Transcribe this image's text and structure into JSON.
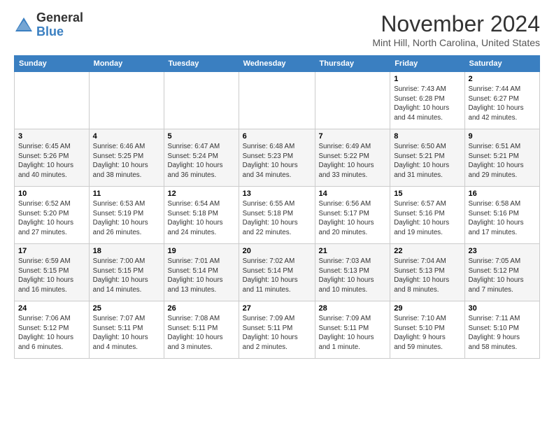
{
  "logo": {
    "general": "General",
    "blue": "Blue"
  },
  "header": {
    "month_title": "November 2024",
    "location": "Mint Hill, North Carolina, United States"
  },
  "weekdays": [
    "Sunday",
    "Monday",
    "Tuesday",
    "Wednesday",
    "Thursday",
    "Friday",
    "Saturday"
  ],
  "weeks": [
    [
      {
        "day": "",
        "detail": ""
      },
      {
        "day": "",
        "detail": ""
      },
      {
        "day": "",
        "detail": ""
      },
      {
        "day": "",
        "detail": ""
      },
      {
        "day": "",
        "detail": ""
      },
      {
        "day": "1",
        "detail": "Sunrise: 7:43 AM\nSunset: 6:28 PM\nDaylight: 10 hours\nand 44 minutes."
      },
      {
        "day": "2",
        "detail": "Sunrise: 7:44 AM\nSunset: 6:27 PM\nDaylight: 10 hours\nand 42 minutes."
      }
    ],
    [
      {
        "day": "3",
        "detail": "Sunrise: 6:45 AM\nSunset: 5:26 PM\nDaylight: 10 hours\nand 40 minutes."
      },
      {
        "day": "4",
        "detail": "Sunrise: 6:46 AM\nSunset: 5:25 PM\nDaylight: 10 hours\nand 38 minutes."
      },
      {
        "day": "5",
        "detail": "Sunrise: 6:47 AM\nSunset: 5:24 PM\nDaylight: 10 hours\nand 36 minutes."
      },
      {
        "day": "6",
        "detail": "Sunrise: 6:48 AM\nSunset: 5:23 PM\nDaylight: 10 hours\nand 34 minutes."
      },
      {
        "day": "7",
        "detail": "Sunrise: 6:49 AM\nSunset: 5:22 PM\nDaylight: 10 hours\nand 33 minutes."
      },
      {
        "day": "8",
        "detail": "Sunrise: 6:50 AM\nSunset: 5:21 PM\nDaylight: 10 hours\nand 31 minutes."
      },
      {
        "day": "9",
        "detail": "Sunrise: 6:51 AM\nSunset: 5:21 PM\nDaylight: 10 hours\nand 29 minutes."
      }
    ],
    [
      {
        "day": "10",
        "detail": "Sunrise: 6:52 AM\nSunset: 5:20 PM\nDaylight: 10 hours\nand 27 minutes."
      },
      {
        "day": "11",
        "detail": "Sunrise: 6:53 AM\nSunset: 5:19 PM\nDaylight: 10 hours\nand 26 minutes."
      },
      {
        "day": "12",
        "detail": "Sunrise: 6:54 AM\nSunset: 5:18 PM\nDaylight: 10 hours\nand 24 minutes."
      },
      {
        "day": "13",
        "detail": "Sunrise: 6:55 AM\nSunset: 5:18 PM\nDaylight: 10 hours\nand 22 minutes."
      },
      {
        "day": "14",
        "detail": "Sunrise: 6:56 AM\nSunset: 5:17 PM\nDaylight: 10 hours\nand 20 minutes."
      },
      {
        "day": "15",
        "detail": "Sunrise: 6:57 AM\nSunset: 5:16 PM\nDaylight: 10 hours\nand 19 minutes."
      },
      {
        "day": "16",
        "detail": "Sunrise: 6:58 AM\nSunset: 5:16 PM\nDaylight: 10 hours\nand 17 minutes."
      }
    ],
    [
      {
        "day": "17",
        "detail": "Sunrise: 6:59 AM\nSunset: 5:15 PM\nDaylight: 10 hours\nand 16 minutes."
      },
      {
        "day": "18",
        "detail": "Sunrise: 7:00 AM\nSunset: 5:15 PM\nDaylight: 10 hours\nand 14 minutes."
      },
      {
        "day": "19",
        "detail": "Sunrise: 7:01 AM\nSunset: 5:14 PM\nDaylight: 10 hours\nand 13 minutes."
      },
      {
        "day": "20",
        "detail": "Sunrise: 7:02 AM\nSunset: 5:14 PM\nDaylight: 10 hours\nand 11 minutes."
      },
      {
        "day": "21",
        "detail": "Sunrise: 7:03 AM\nSunset: 5:13 PM\nDaylight: 10 hours\nand 10 minutes."
      },
      {
        "day": "22",
        "detail": "Sunrise: 7:04 AM\nSunset: 5:13 PM\nDaylight: 10 hours\nand 8 minutes."
      },
      {
        "day": "23",
        "detail": "Sunrise: 7:05 AM\nSunset: 5:12 PM\nDaylight: 10 hours\nand 7 minutes."
      }
    ],
    [
      {
        "day": "24",
        "detail": "Sunrise: 7:06 AM\nSunset: 5:12 PM\nDaylight: 10 hours\nand 6 minutes."
      },
      {
        "day": "25",
        "detail": "Sunrise: 7:07 AM\nSunset: 5:11 PM\nDaylight: 10 hours\nand 4 minutes."
      },
      {
        "day": "26",
        "detail": "Sunrise: 7:08 AM\nSunset: 5:11 PM\nDaylight: 10 hours\nand 3 minutes."
      },
      {
        "day": "27",
        "detail": "Sunrise: 7:09 AM\nSunset: 5:11 PM\nDaylight: 10 hours\nand 2 minutes."
      },
      {
        "day": "28",
        "detail": "Sunrise: 7:09 AM\nSunset: 5:11 PM\nDaylight: 10 hours\nand 1 minute."
      },
      {
        "day": "29",
        "detail": "Sunrise: 7:10 AM\nSunset: 5:10 PM\nDaylight: 9 hours\nand 59 minutes."
      },
      {
        "day": "30",
        "detail": "Sunrise: 7:11 AM\nSunset: 5:10 PM\nDaylight: 9 hours\nand 58 minutes."
      }
    ]
  ]
}
